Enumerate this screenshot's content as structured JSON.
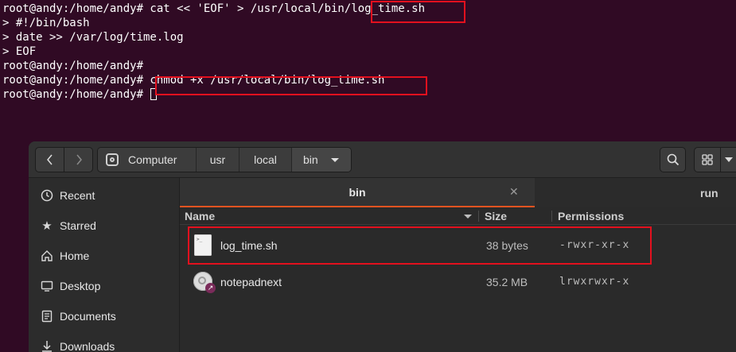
{
  "terminal": {
    "lines": [
      "root@andy:/home/andy# cat << 'EOF' > /usr/local/bin/log_time.sh",
      "> #!/bin/bash",
      "> date >> /var/log/time.log",
      "> EOF",
      "root@andy:/home/andy#",
      "root@andy:/home/andy# chmod +x /usr/local/bin/log_time.sh",
      "root@andy:/home/andy# "
    ]
  },
  "files": {
    "path": [
      "Computer",
      "usr",
      "local",
      "bin"
    ],
    "tabs": [
      {
        "label": "bin",
        "active": true
      },
      {
        "label": "run",
        "active": false
      }
    ],
    "sidebar": [
      {
        "label": "Recent",
        "icon": "clock-icon"
      },
      {
        "label": "Starred",
        "icon": "star-icon"
      },
      {
        "label": "Home",
        "icon": "home-icon"
      },
      {
        "label": "Desktop",
        "icon": "desktop-icon"
      },
      {
        "label": "Documents",
        "icon": "document-icon"
      },
      {
        "label": "Downloads",
        "icon": "download-icon"
      }
    ],
    "columns": {
      "name": "Name",
      "size": "Size",
      "permissions": "Permissions"
    },
    "rows": [
      {
        "name": "log_time.sh",
        "size": "38 bytes",
        "permissions": "-rwxr-xr-x",
        "icon": "script-file-icon"
      },
      {
        "name": "notepadnext",
        "size": "35.2 MB",
        "permissions": "lrwxrwxr-x",
        "icon": "application-symlink-icon"
      }
    ]
  },
  "colors": {
    "terminal_bg": "#300a24",
    "highlight": "#e3101e",
    "accent": "#e95420"
  }
}
